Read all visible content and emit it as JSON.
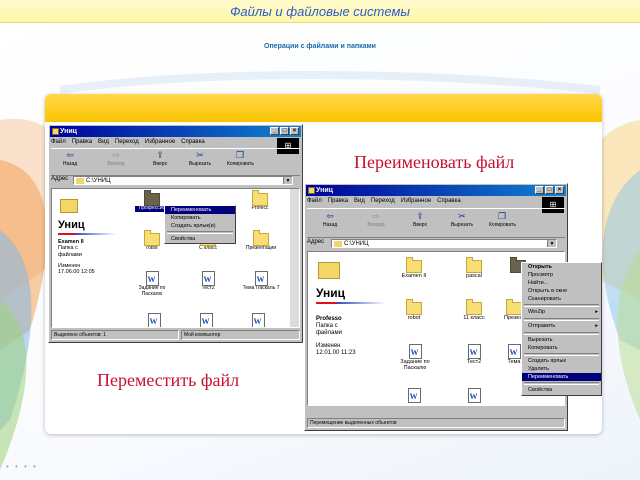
{
  "slide": {
    "title": "Файлы и файловые системы",
    "subtitle": "Операции с файлами и папками",
    "caption_rename": "Переименовать файл",
    "caption_move": "Переместить файл",
    "footer_dots": "• • • •",
    "colors": {
      "title_bar": "#fff7a8",
      "title_text": "#2a5cc8",
      "subtitle": "#1a6aa8",
      "panel_band": "#f9c400",
      "caption": "#c8102e"
    }
  },
  "win1": {
    "title": "Униц",
    "menu": [
      "Файл",
      "Правка",
      "Вид",
      "Переход",
      "Избранное",
      "Справка"
    ],
    "toolbar": [
      "Назад",
      "Вперед",
      "Вверх",
      "Вырезать",
      "Копировать"
    ],
    "address_label": "Адрес",
    "address": "C:\\УНИЦ",
    "pane_title": "Униц",
    "pane_lines": [
      "Examen II",
      "Папка с",
      "файлами",
      "",
      "Изменен",
      "17.06.00 12:05"
    ],
    "files": [
      {
        "label": "Профессио",
        "icon": "folder"
      },
      {
        "label": "Profecc",
        "icon": "folder"
      },
      {
        "label": "robot",
        "icon": "folder"
      },
      {
        "label": "С класс",
        "icon": "folder"
      },
      {
        "label": "Презентации",
        "icon": "folder"
      },
      {
        "label": "Задание по Паскалю",
        "icon": "word-doc"
      },
      {
        "label": "Тест2",
        "icon": "word-doc"
      },
      {
        "label": "Тема Паскаль 7",
        "icon": "word-doc"
      }
    ],
    "context_menu": [
      "Переименовать",
      "Копировать",
      "Создать ярлык(и)",
      "Свойства"
    ],
    "context_menu_highlight": "Переименовать",
    "status": [
      "Выделено объектов: 1",
      "Мой компьютер"
    ]
  },
  "win2": {
    "title": "Униц",
    "menu": [
      "Файл",
      "Правка",
      "Вид",
      "Переход",
      "Избранное",
      "Справка"
    ],
    "toolbar": [
      "Назад",
      "Вперед",
      "Вверх",
      "Вырезать",
      "Копировать"
    ],
    "address_label": "Адрес",
    "address": "C:\\УНИЦ",
    "pane_title": "Униц",
    "pane_lines": [
      "Professo",
      "Папка с",
      "файлами",
      "",
      "Изменен",
      "12.01.00 11:23"
    ],
    "files": [
      {
        "label": "Examen II",
        "icon": "folder"
      },
      {
        "label": "pascal",
        "icon": "folder"
      },
      {
        "label": "Profecc",
        "icon": "folder"
      },
      {
        "label": "robot",
        "icon": "folder"
      },
      {
        "label": "11 класс",
        "icon": "folder"
      },
      {
        "label": "Презентации",
        "icon": "folder"
      },
      {
        "label": "Задание по Паскалю",
        "icon": "word-doc"
      },
      {
        "label": "Тест2",
        "icon": "word-doc"
      },
      {
        "label": "Тема",
        "icon": "word-doc"
      }
    ],
    "context_menu": [
      "Открыть",
      "Просмотр",
      "Найти...",
      "Открыть в окне",
      "Сканировать",
      "WinZip",
      "Отправить",
      "Вырезать",
      "Копировать",
      "Создать ярлык",
      "Удалить",
      "Переименовать",
      "Свойства"
    ],
    "context_menu_highlight": "Переименовать",
    "status": "Перемещение выделенных объектов"
  }
}
